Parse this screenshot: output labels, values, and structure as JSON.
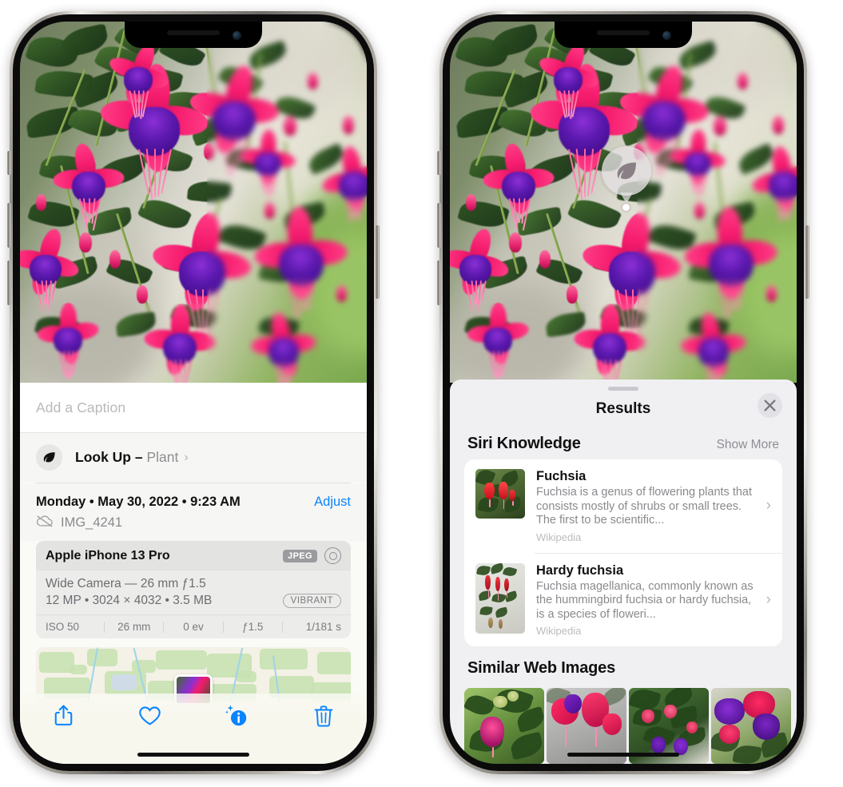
{
  "left_phone": {
    "photo": {
      "alt": "fuchsia-flowers-photo"
    },
    "caption": {
      "placeholder": "Add a Caption",
      "value": ""
    },
    "lookup": {
      "label": "Look Up –",
      "subject": "Plant",
      "chevron": "›",
      "icon": "leaf-icon"
    },
    "metadata": {
      "date": "Monday • May 30, 2022 • 9:23 AM",
      "adjust_label": "Adjust",
      "cloud_icon": "icloud-slash-icon",
      "filename": "IMG_4241"
    },
    "camera_card": {
      "device": "Apple iPhone 13 Pro",
      "format_tag": "JPEG",
      "lens_icon": "aperture-icon",
      "lens_line": "Wide Camera — 26 mm ƒ1.5",
      "specs_line": "12 MP • 3024 × 4032 • 3.5 MB",
      "style_tag": "VIBRANT",
      "exif": [
        "ISO 50",
        "26 mm",
        "0 ev",
        "ƒ1.5",
        "1/181 s"
      ]
    },
    "map": {
      "label": "photo-location-map"
    },
    "toolbar": [
      {
        "name": "share-button",
        "icon": "share-icon"
      },
      {
        "name": "favorite-button",
        "icon": "heart-icon"
      },
      {
        "name": "info-button",
        "icon": "info-sparkle-icon"
      },
      {
        "name": "delete-button",
        "icon": "trash-icon"
      }
    ]
  },
  "right_phone": {
    "visual_lookup_badge": {
      "icon": "leaf-icon"
    },
    "sheet": {
      "title": "Results",
      "close_icon": "close-icon",
      "sections": [
        {
          "title": "Siri Knowledge",
          "action": "Show More",
          "entries": [
            {
              "name": "Fuchsia",
              "description": "Fuchsia is a genus of flowering plants that consists mostly of shrubs or small trees. The first to be scientific...",
              "source": "Wikipedia",
              "chevron": "›"
            },
            {
              "name": "Hardy fuchsia",
              "description": "Fuchsia magellanica, commonly known as the hummingbird fuchsia or hardy fuchsia, is a species of floweri...",
              "source": "Wikipedia",
              "chevron": "›"
            }
          ]
        },
        {
          "title": "Similar Web Images",
          "thumbnails": [
            "fuchsia-web-image-1",
            "fuchsia-web-image-2",
            "fuchsia-web-image-3",
            "fuchsia-web-image-4"
          ]
        }
      ]
    }
  },
  "colors": {
    "accent_blue": "#0a84ff",
    "sheet_bg": "#f0f0f3",
    "card_bg": "#ffffff",
    "secondary_text": "#8a8a8e",
    "tag_gray": "#9b9b9f"
  }
}
